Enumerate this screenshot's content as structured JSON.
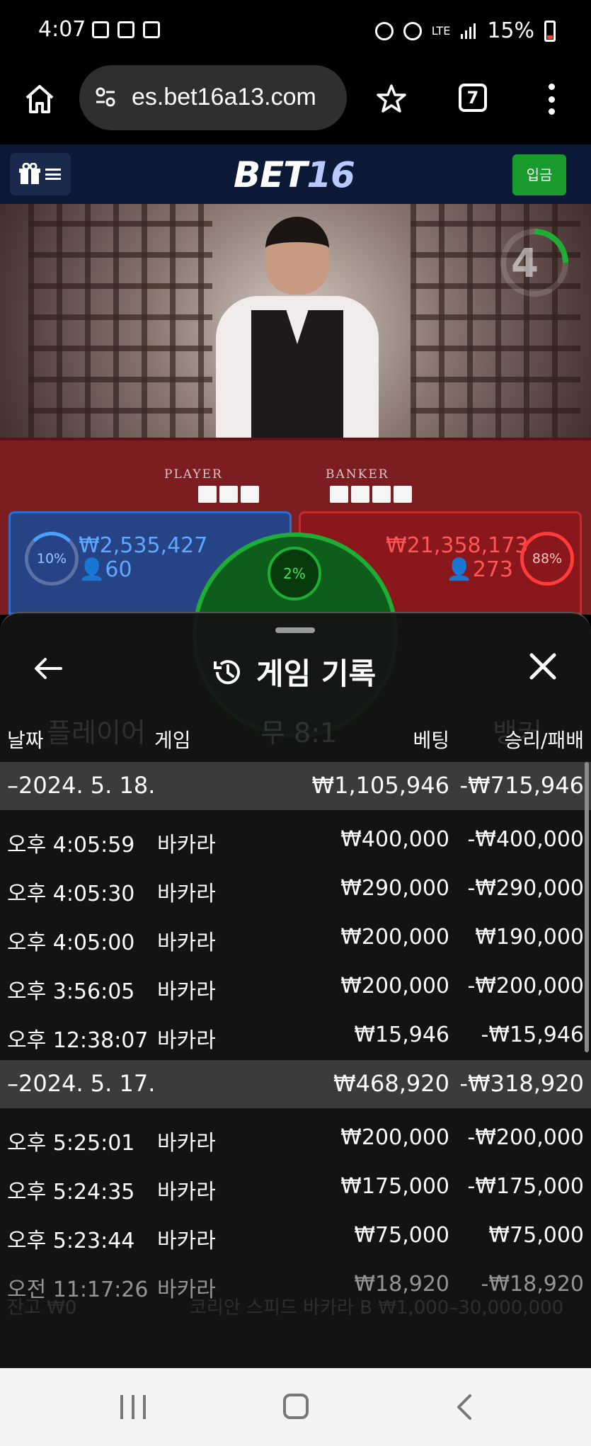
{
  "status_bar": {
    "time": "4:07",
    "network": "LTE",
    "battery": "15%"
  },
  "browser": {
    "url": "es.bet16a13.com",
    "tab_count": "7"
  },
  "site_header": {
    "logo_main": "BET",
    "logo_accent": "16",
    "deposit_label": "입금"
  },
  "video": {
    "countdown": "4",
    "player_label": "PLAYER",
    "banker_label": "BANKER",
    "player_pct": "10%",
    "player_amount": "₩2,535,427",
    "player_count": "👤60",
    "banker_pct": "88%",
    "banker_amount": "₩21,358,173",
    "banker_count": "👤273",
    "tie_pct": "2%"
  },
  "history": {
    "title": "게임 기록",
    "columns": {
      "date": "날짜",
      "game": "게임",
      "bet": "베팅",
      "result": "승리/패배"
    },
    "groups": [
      {
        "date": "–2024. 5. 18.",
        "bet_total": "₩1,105,946",
        "result_total": "-₩715,946",
        "rows": [
          {
            "time": "오후 4:05:59",
            "game": "바카라",
            "bet": "₩400,000",
            "result": "-₩400,000"
          },
          {
            "time": "오후 4:05:30",
            "game": "바카라",
            "bet": "₩290,000",
            "result": "-₩290,000"
          },
          {
            "time": "오후 4:05:00",
            "game": "바카라",
            "bet": "₩200,000",
            "result": "₩190,000"
          },
          {
            "time": "오후 3:56:05",
            "game": "바카라",
            "bet": "₩200,000",
            "result": "-₩200,000"
          },
          {
            "time": "오후 12:38:07",
            "game": "바카라",
            "bet": "₩15,946",
            "result": "-₩15,946"
          }
        ]
      },
      {
        "date": "–2024. 5. 17.",
        "bet_total": "₩468,920",
        "result_total": "-₩318,920",
        "rows": [
          {
            "time": "오후 5:25:01",
            "game": "바카라",
            "bet": "₩200,000",
            "result": "-₩200,000"
          },
          {
            "time": "오후 5:24:35",
            "game": "바카라",
            "bet": "₩175,000",
            "result": "-₩175,000"
          },
          {
            "time": "오후 5:23:44",
            "game": "바카라",
            "bet": "₩75,000",
            "result": "₩75,000"
          },
          {
            "time": "오전 11:17:26",
            "game": "바카라",
            "bet": "₩18,920",
            "result": "-₩18,920"
          }
        ]
      }
    ]
  },
  "ghost_text": {
    "player": "플레이어",
    "tie": "무 8:1",
    "banker": "뱅커",
    "balance": "잔고 ₩0",
    "table_name": "코리안 스피드 바카라 B ₩1,000–30,000,000"
  },
  "colors": {
    "header_bg": "#0b1936",
    "deposit_green": "#1a9b2e",
    "player_blue": "#2e6fd1",
    "banker_red": "#c42a2a",
    "tie_green": "#1fae35"
  }
}
